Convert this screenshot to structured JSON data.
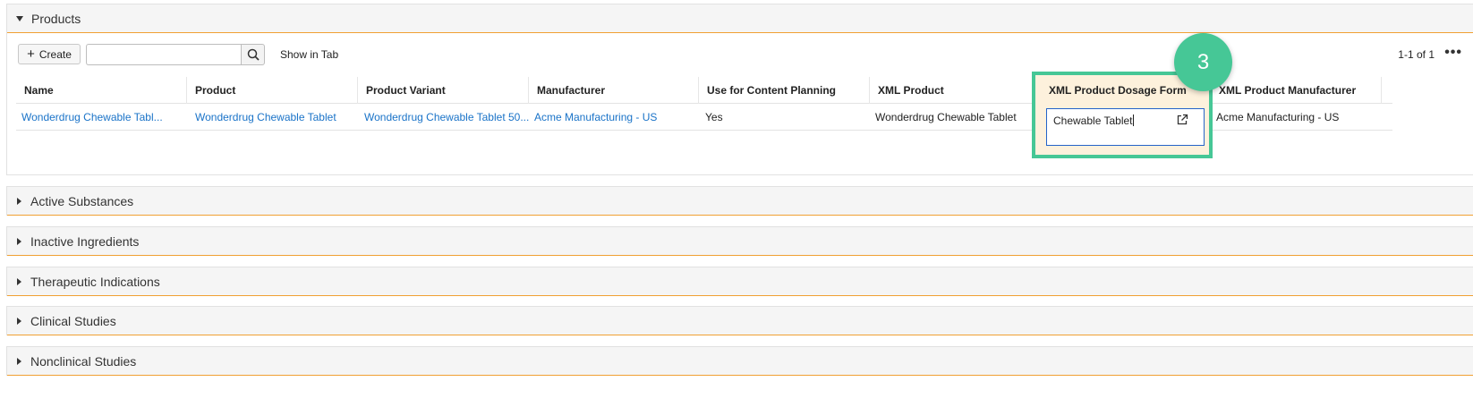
{
  "products_section": {
    "title": "Products",
    "create_label": "Create",
    "search_placeholder": "",
    "show_in_tab": "Show in Tab",
    "pager": "1-1 of 1",
    "more": "•••",
    "columns": [
      "Name",
      "Product",
      "Product Variant",
      "Manufacturer",
      "Use for Content Planning",
      "XML Product",
      "XML Product Dosage Form",
      "XML Product Manufacturer"
    ],
    "row": {
      "name": "Wonderdrug Chewable Tabl...",
      "product": "Wonderdrug Chewable Tablet",
      "product_variant": "Wonderdrug Chewable Tablet 50...",
      "manufacturer": "Acme Manufacturing - US",
      "use_for_content_planning": "Yes",
      "xml_product": "Wonderdrug Chewable Tablet",
      "xml_product_dosage_form": "Chewable Tablet",
      "xml_product_manufacturer": "Acme Manufacturing - US"
    }
  },
  "callout": {
    "number": "3",
    "color": "#46c796"
  },
  "collapsed_sections": [
    "Active Substances",
    "Inactive Ingredients",
    "Therapeutic Indications",
    "Clinical Studies",
    "Nonclinical Studies"
  ],
  "colors": {
    "accent_border": "#f0a033",
    "link": "#1a73c8",
    "focus": "#2563c9",
    "highlight": "#fdf1dc"
  }
}
